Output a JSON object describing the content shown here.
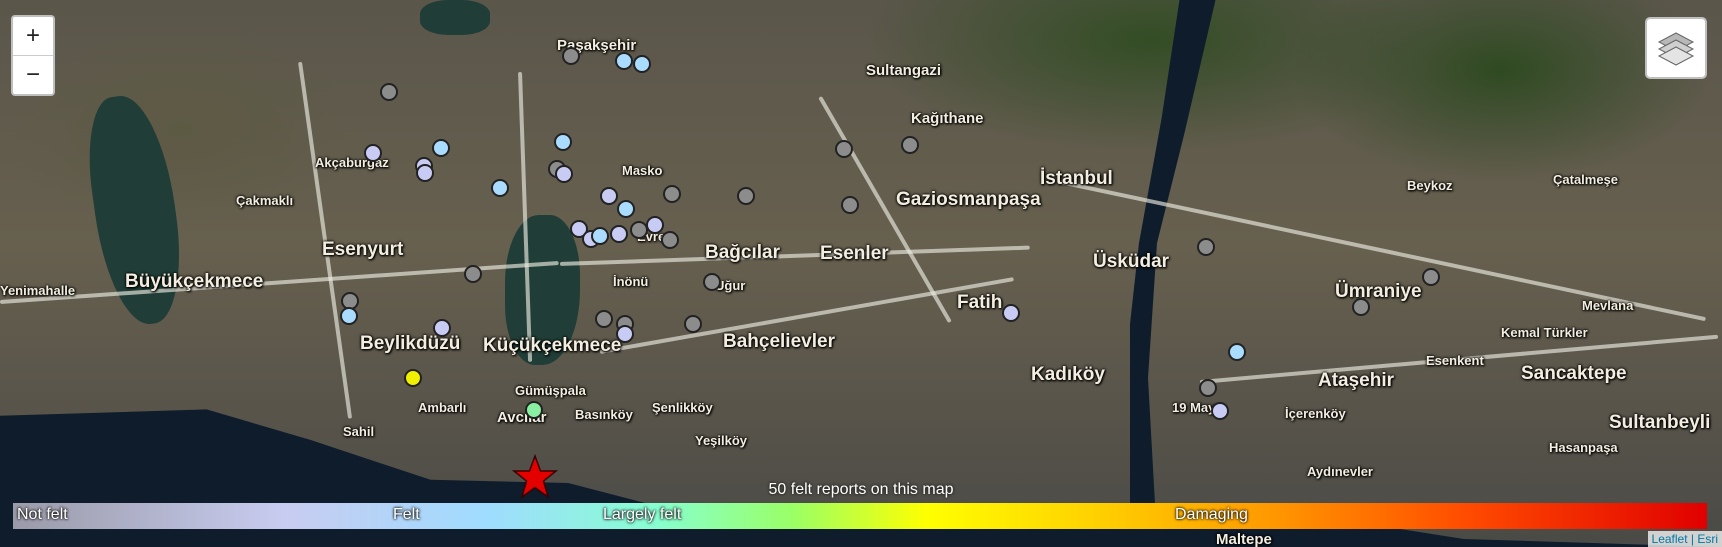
{
  "map": {
    "zoom_in_label": "+",
    "zoom_out_label": "−",
    "layers_icon": "layers-icon",
    "felt_count_text": "50 felt reports on this map",
    "scale": {
      "labels": [
        "Not felt",
        "Felt",
        "Largely felt",
        "Damaging"
      ]
    },
    "attribution": "Leaflet | Esri",
    "epicenter_icon": "star-icon",
    "epicenter_color": "#e50000",
    "places": [
      {
        "name": "Paşakşehir"
      },
      {
        "name": "Sultangazi"
      },
      {
        "name": "Kağıthane"
      },
      {
        "name": "Akçaburgaz"
      },
      {
        "name": "Çakmaklı"
      },
      {
        "name": "Büyükçekmece"
      },
      {
        "name": "Esenyurt"
      },
      {
        "name": "Yenimahalle"
      },
      {
        "name": "Beylikdüzü"
      },
      {
        "name": "Küçükçekmece"
      },
      {
        "name": "Gümüşpala"
      },
      {
        "name": "Ambarlı"
      },
      {
        "name": "Avcılar"
      },
      {
        "name": "Sahil"
      },
      {
        "name": "Basınköy"
      },
      {
        "name": "Şenlikköy"
      },
      {
        "name": "Yeşilköy"
      },
      {
        "name": "İnönü"
      },
      {
        "name": "Bağcılar"
      },
      {
        "name": "Bahçelievler"
      },
      {
        "name": "Esenler"
      },
      {
        "name": "Gaziosmanpaşa"
      },
      {
        "name": "İstanbul"
      },
      {
        "name": "Fatih"
      },
      {
        "name": "Üsküdar"
      },
      {
        "name": "Kadıköy"
      },
      {
        "name": "Ümraniye"
      },
      {
        "name": "Ataşehir"
      },
      {
        "name": "Sancaktepe"
      },
      {
        "name": "Sultanbeyli"
      },
      {
        "name": "Beykoz"
      },
      {
        "name": "Çatalmeşe"
      },
      {
        "name": "Mevlana"
      },
      {
        "name": "Kemal Türkler"
      },
      {
        "name": "Esenkent"
      },
      {
        "name": "İçerenköy"
      },
      {
        "name": "Hasanpaşa"
      },
      {
        "name": "Aydınevler"
      },
      {
        "name": "19 Mayıs"
      },
      {
        "name": "Maltepe"
      },
      {
        "name": "Masko"
      },
      {
        "name": "Uğur"
      },
      {
        "name": "Evren"
      }
    ],
    "report_colors": {
      "not_felt": "#8c8c8c",
      "felt_weak": "#c8ccf5",
      "felt": "#a9dcff",
      "strong": "#88f0a0",
      "very_strong": "#f0f000"
    }
  }
}
